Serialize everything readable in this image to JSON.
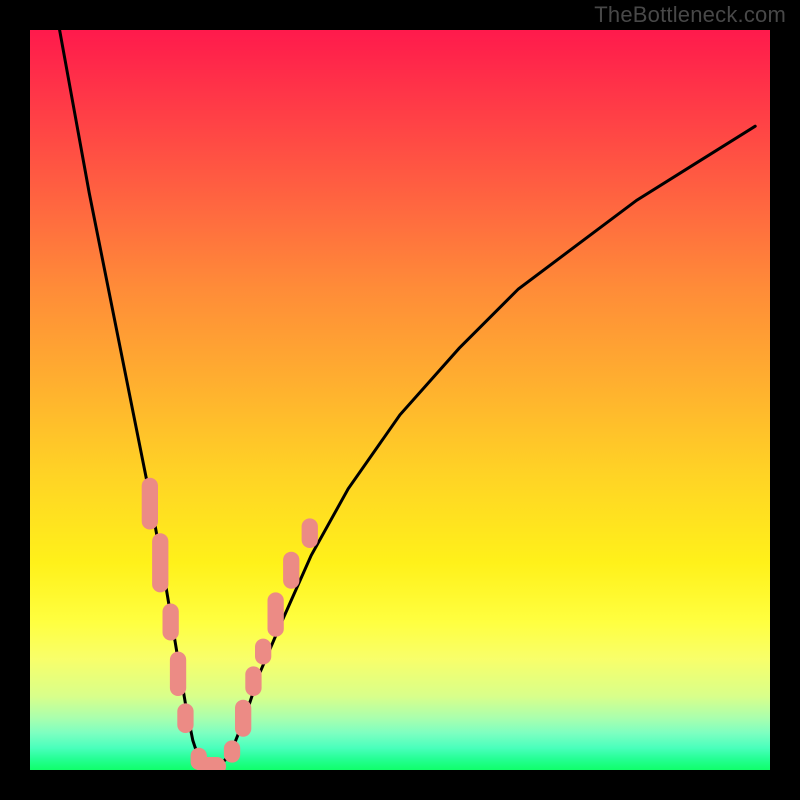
{
  "watermark": "TheBottleneck.com",
  "colors": {
    "frame": "#000000",
    "curve": "#000000",
    "marker": "#ec8b85",
    "watermark": "#484848"
  },
  "chart_data": {
    "type": "line",
    "title": "",
    "xlabel": "",
    "ylabel": "",
    "xlim": [
      0,
      100
    ],
    "ylim": [
      0,
      100
    ],
    "note": "V-shaped bottleneck curve; y≈0 at optimum, rises toward 100 away from optimum. Axes unlabeled in image; values are estimated from pixel geometry.",
    "series": [
      {
        "name": "bottleneck-curve",
        "x": [
          4,
          6,
          8,
          10,
          12,
          14,
          16,
          18,
          19,
          20,
          21,
          22,
          23,
          24,
          25,
          27,
          29,
          31,
          34,
          38,
          43,
          50,
          58,
          66,
          74,
          82,
          90,
          98
        ],
        "y": [
          100,
          89,
          78,
          68,
          58,
          48,
          38,
          27,
          21,
          15,
          9,
          4,
          1,
          0,
          0,
          2,
          7,
          13,
          20,
          29,
          38,
          48,
          57,
          65,
          71,
          77,
          82,
          87
        ]
      }
    ],
    "markers": {
      "name": "highlighted-points",
      "shape": "rounded-rect",
      "color": "#ec8b85",
      "points": [
        {
          "x": 16.2,
          "y": 36,
          "w": 2.2,
          "h": 7
        },
        {
          "x": 17.6,
          "y": 28,
          "w": 2.2,
          "h": 8
        },
        {
          "x": 19.0,
          "y": 20,
          "w": 2.2,
          "h": 5
        },
        {
          "x": 20.0,
          "y": 13,
          "w": 2.2,
          "h": 6
        },
        {
          "x": 21.0,
          "y": 7,
          "w": 2.2,
          "h": 4
        },
        {
          "x": 22.8,
          "y": 1.5,
          "w": 2.2,
          "h": 3
        },
        {
          "x": 24.5,
          "y": 0.5,
          "w": 4.0,
          "h": 2.5
        },
        {
          "x": 27.3,
          "y": 2.5,
          "w": 2.2,
          "h": 3
        },
        {
          "x": 28.8,
          "y": 7,
          "w": 2.2,
          "h": 5
        },
        {
          "x": 30.2,
          "y": 12,
          "w": 2.2,
          "h": 4
        },
        {
          "x": 31.5,
          "y": 16,
          "w": 2.2,
          "h": 3.5
        },
        {
          "x": 33.2,
          "y": 21,
          "w": 2.2,
          "h": 6
        },
        {
          "x": 35.3,
          "y": 27,
          "w": 2.2,
          "h": 5
        },
        {
          "x": 37.8,
          "y": 32,
          "w": 2.2,
          "h": 4
        }
      ]
    }
  }
}
